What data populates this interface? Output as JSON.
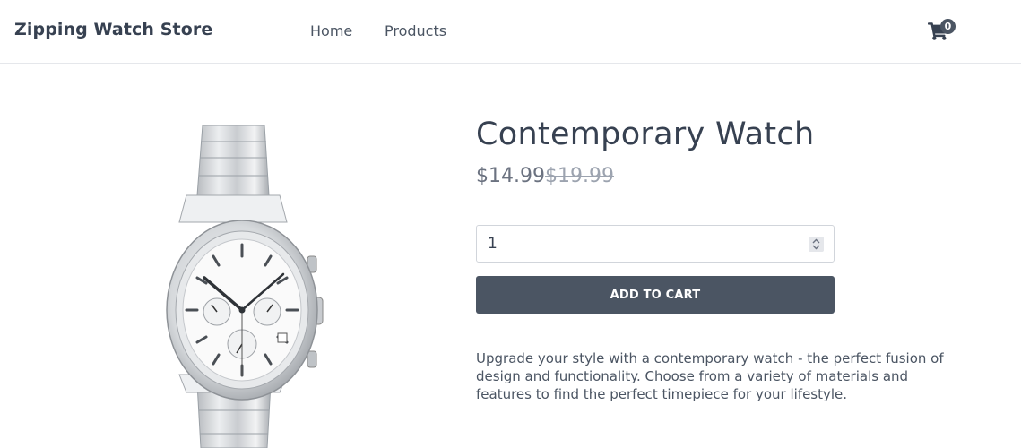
{
  "header": {
    "brand": "Zipping Watch Store",
    "nav": {
      "home": "Home",
      "products": "Products"
    },
    "cart": {
      "icon": "shopping-cart-icon",
      "count": "0"
    }
  },
  "product": {
    "image_alt": "Contemporary Watch",
    "title": "Contemporary Watch",
    "price": "$14.99",
    "original_price": "$19.99",
    "quantity": "1",
    "add_to_cart_label": "ADD TO CART",
    "description": "Upgrade your style with a contemporary watch - the perfect fusion of design and functionality. Choose from a variety of materials and features to find the perfect timepiece for your lifestyle."
  },
  "colors": {
    "primary": "#4b5563",
    "text": "#374151",
    "muted": "#9ca3af"
  }
}
